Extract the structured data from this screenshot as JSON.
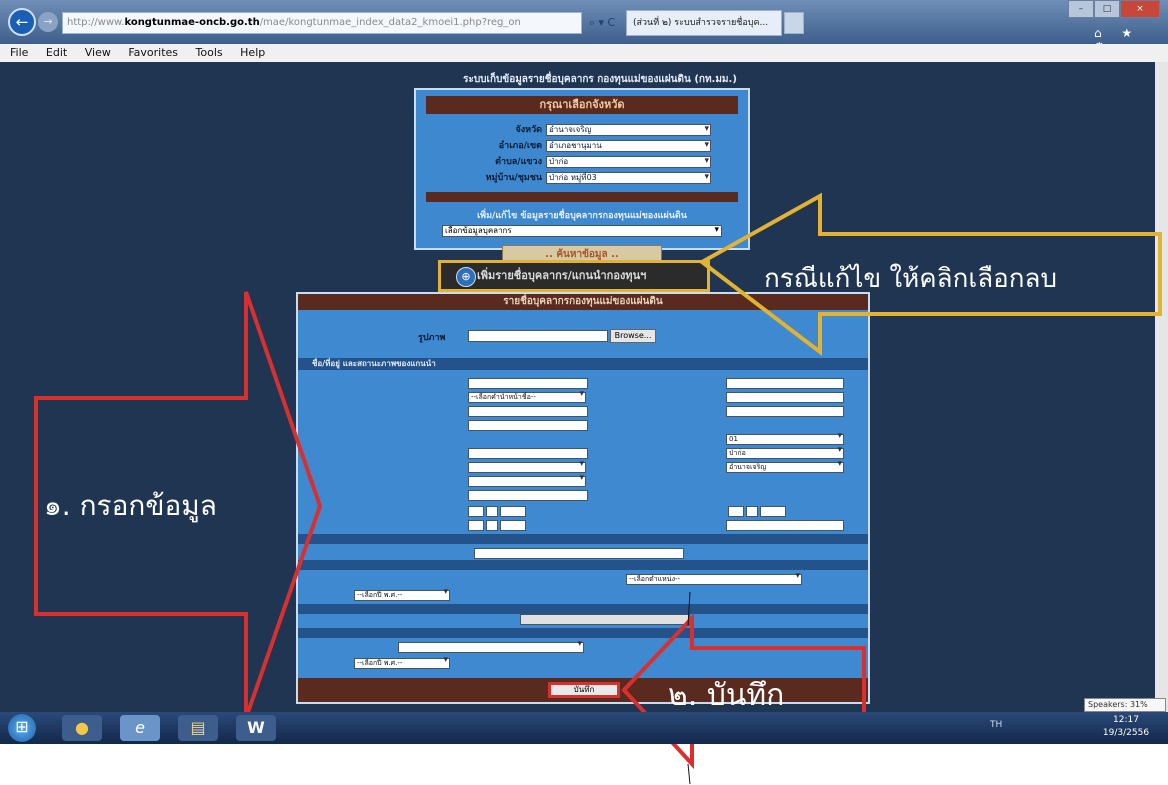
{
  "browser": {
    "back_glyph": "←",
    "forward_glyph": "→",
    "address_prefix": "http://www.",
    "address_host": "kongtunmae-oncb.go.th",
    "address_rest": "/mae/kongtunmae_index_data2_kmoei1.php?reg_on",
    "address_tools": "⌕ ▾ C",
    "tab_title": "(ส่วนที่ ๒) ระบบสำรวจรายชื่อบุค...",
    "tab_close": "×",
    "window_controls": [
      "–",
      "□",
      "×"
    ],
    "fav_icons": "⌂ ★ ⚙"
  },
  "menu": [
    "File",
    "Edit",
    "View",
    "Favorites",
    "Tools",
    "Help"
  ],
  "page": {
    "heading": "ระบบเก็บข้อมูลรายชื่อบุคลากร กองทุนแม่ของแผ่นดิน (กท.มม.)",
    "panel_title": "กรุณาเลือกจังหวัด",
    "filters": [
      {
        "label": "จังหวัด",
        "value": "อำนาจเจริญ"
      },
      {
        "label": "อำเภอ/เขต",
        "value": "อำเภอชานุมาน"
      },
      {
        "label": "ตำบล/แขวง",
        "value": "ป่าก่อ"
      },
      {
        "label": "หมู่บ้าน/ชุมชน",
        "value": "ป่าก่อ หมู่ที่03"
      }
    ],
    "search_label": "เพิ่ม/แก้ไข ข้อมูลรายชื่อบุคลากรกองทุนแม่ของแผ่นดิน",
    "search_select": "เลือกข้อมูลบุคลากร",
    "search_button": ".. ค้นหาข้อมูล ..",
    "add_button": "เพิ่มรายชื่อบุคลากร/แกนนำกองทุนฯ",
    "add_icon": "⊕"
  },
  "form": {
    "title": "รายชื่อบุคลากรกองทุนแม่ของแผ่นดิน",
    "photo_label": "รูปภาพ",
    "browse_button": "Browse...",
    "section1": "ชื่อ/ที่อยู่ และสถานะภาพของแกนนำ",
    "prefix_select": "--เลือกคำนำหน้าชื่อ--",
    "village_no": "01",
    "tambon_select": "ป่าก่อ",
    "amphoe_select": "ชานุมาน",
    "province_select": "อำนาจเจริญ",
    "year_select_1": "--เลือกปี พ.ศ.--",
    "position_select": "--เลือกตำแหน่ง--",
    "year_select_2": "--เลือกปี พ.ศ.--",
    "save_button": "บันทึก"
  },
  "annotations": {
    "callout": "กรณีแก้ไข ให้คลิกเลือกลบ",
    "step1": "๑. กรอกข้อมูล",
    "step2": "๒. บันทึก"
  },
  "taskbar": {
    "start": "⊞",
    "apps": [
      "●",
      "e",
      "▤",
      "W"
    ],
    "tray": "TH",
    "clock_time": "12:17",
    "clock_date": "19/3/2556",
    "speaker_tip": "Speakers: 31%"
  },
  "colors": {
    "page_bg": "#1f3552",
    "panel_blue": "#3e88cf",
    "header_brown": "#5a2a1e",
    "highlight_yellow": "#e2b233",
    "arrow_red": "#d8302f"
  }
}
